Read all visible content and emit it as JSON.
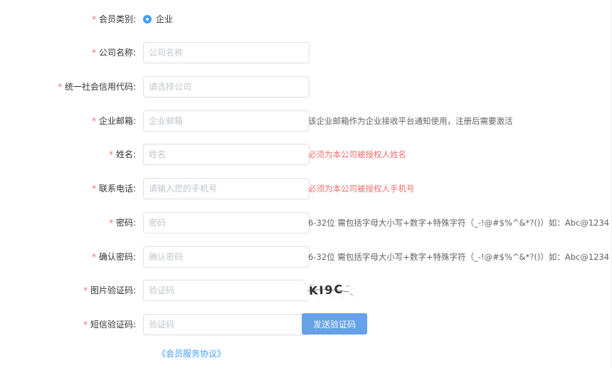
{
  "form": {
    "member_type": {
      "required_mark": "*",
      "label": "会员类别:",
      "option_label": "企业"
    },
    "fields": [
      {
        "key": "company_name",
        "required_mark": "*",
        "label": "公司名称:",
        "placeholder": "公司名称",
        "hint": "",
        "hint_red": false
      },
      {
        "key": "credit_code",
        "required_mark": "*",
        "label": "统一社会信用代码:",
        "placeholder": "请选择公司",
        "hint": "",
        "hint_red": false
      },
      {
        "key": "company_email",
        "required_mark": "*",
        "label": "企业邮箱:",
        "placeholder": "企业邮箱",
        "hint": "该企业邮箱作为企业接收平台通知使用，注册后需要激活",
        "hint_red": false
      },
      {
        "key": "name",
        "required_mark": "*",
        "label": "姓名:",
        "placeholder": "姓名",
        "hint": "必须为本公司被授权人姓名",
        "hint_red": true
      },
      {
        "key": "phone",
        "required_mark": "*",
        "label": "联系电话:",
        "placeholder": "请输入您的手机号",
        "hint": "必须为本公司被授权人手机号",
        "hint_red": true
      },
      {
        "key": "password",
        "required_mark": "*",
        "label": "密码:",
        "placeholder": "密码",
        "hint": "6-32位 需包括字母大小写+数字+特殊字符（_-!@#$%^&*?()）如：Abc@1234",
        "hint_red": false
      },
      {
        "key": "confirm_password",
        "required_mark": "*",
        "label": "确认密码:",
        "placeholder": "确认密码",
        "hint": "6-32位 需包括字母大小写+数字+特殊字符（_-!@#$%^&*?()）如：Abc@1234",
        "hint_red": false
      }
    ],
    "image_captcha": {
      "required_mark": "*",
      "label": "图片验证码:",
      "placeholder": "验证码",
      "captcha_text": "KI9C"
    },
    "sms_code": {
      "required_mark": "*",
      "label": "短信验证码:",
      "placeholder": "验证码",
      "send_button_label": "发送验证码"
    },
    "agreement_link": "《会员服务协议》"
  },
  "colors": {
    "primary": "#409eff",
    "button": "#66a1ea",
    "required": "#f56c6c",
    "border": "#dcdfe6"
  }
}
